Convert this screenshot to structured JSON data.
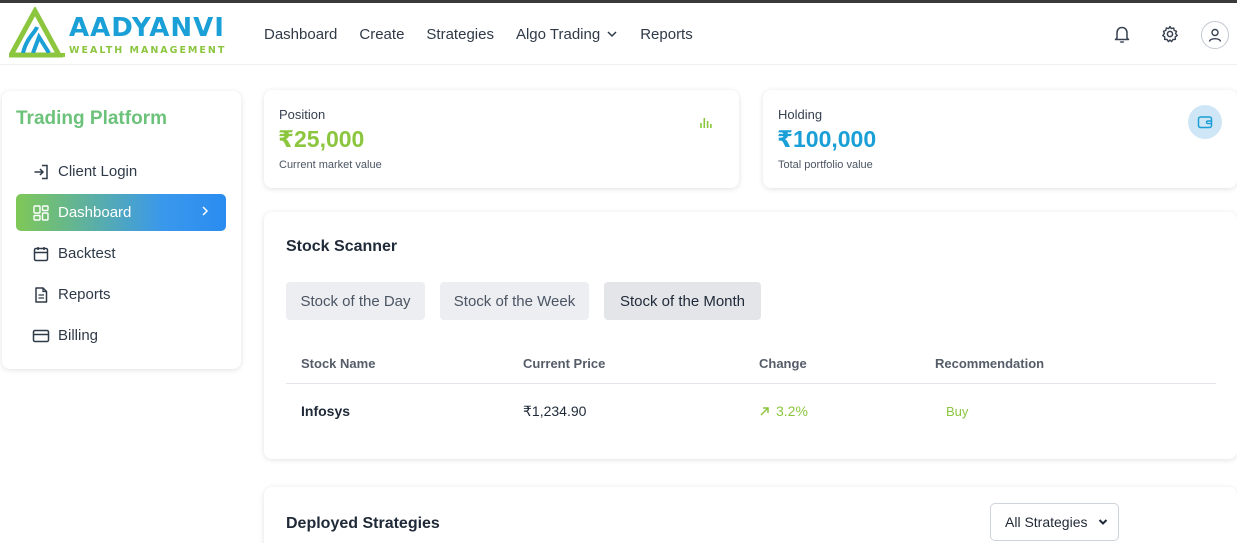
{
  "brand": {
    "name": "AADYANVI",
    "tagline": "WEALTH MANAGEMENT"
  },
  "nav": {
    "items": [
      {
        "label": "Dashboard"
      },
      {
        "label": "Create"
      },
      {
        "label": "Strategies"
      },
      {
        "label": "Algo Trading",
        "dropdown": true
      },
      {
        "label": "Reports"
      }
    ]
  },
  "header_icons": [
    "bell-icon",
    "gear-icon",
    "user-icon"
  ],
  "sidebar": {
    "title": "Trading Platform",
    "items": [
      {
        "label": "Client Login",
        "icon": "login-icon"
      },
      {
        "label": "Dashboard",
        "icon": "grid-icon",
        "active": true
      },
      {
        "label": "Backtest",
        "icon": "calendar-icon"
      },
      {
        "label": "Reports",
        "icon": "document-icon"
      },
      {
        "label": "Billing",
        "icon": "credit-card-icon"
      }
    ]
  },
  "stats": {
    "position": {
      "label": "Position",
      "value": "₹25,000",
      "note": "Current market value",
      "icon": "bar-chart-icon",
      "color": "#8cc63f"
    },
    "holding": {
      "label": "Holding",
      "value": "₹100,000",
      "note": "Total portfolio value",
      "icon": "wallet-icon",
      "color": "#1a9fd6"
    }
  },
  "scanner": {
    "title": "Stock Scanner",
    "tabs": [
      {
        "label": "Stock of the Day"
      },
      {
        "label": "Stock of the Week"
      },
      {
        "label": "Stock of the Month",
        "active": true
      }
    ],
    "columns": [
      "Stock Name",
      "Current Price",
      "Change",
      "Recommendation"
    ],
    "rows": [
      {
        "name": "Infosys",
        "price": "₹1,234.90",
        "change": "3.2%",
        "recommendation": "Buy"
      }
    ]
  },
  "deployed": {
    "title": "Deployed Strategies",
    "filter": {
      "selected": "All Strategies"
    }
  },
  "colors": {
    "accent_green": "#8cc63f",
    "accent_blue": "#1a9fd6",
    "sidebar_title": "#6cc27a"
  }
}
